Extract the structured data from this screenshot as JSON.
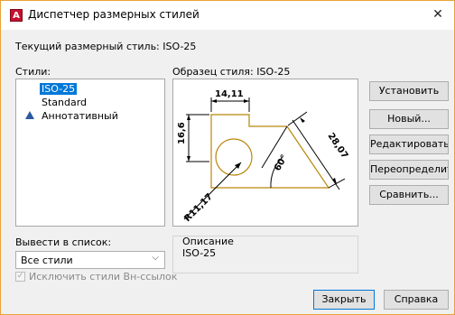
{
  "window": {
    "title": "Диспетчер размерных стилей",
    "icon_letter": "A"
  },
  "current_style_label": "Текущий размерный стиль: ISO-25",
  "styles_label": "Стили:",
  "styles_list": [
    "ISO-25",
    "Standard",
    "Аннотативный"
  ],
  "preview_label": "Образец стиля: ISO-25",
  "preview": {
    "dim_top": "14,11",
    "dim_left": "16,6",
    "dim_diag": "28,07",
    "dim_angle": "60°",
    "dim_radius": "R11,17"
  },
  "buttons": {
    "set": "Установить",
    "new": "Новый...",
    "edit": "Редактировать...",
    "override": "Переопределить...",
    "compare": "Сравнить..."
  },
  "list_filter_label": "Вывести в список:",
  "list_filter_value": "Все стили",
  "exclude_xref_label": "Исключить стили Вн-ссылок",
  "description_label": "Описание",
  "description_value": "ISO-25",
  "close_button": "Закрыть",
  "help_button": "Справка",
  "colors": {
    "accent": "#0078d7",
    "drawing": "#b8860b"
  }
}
